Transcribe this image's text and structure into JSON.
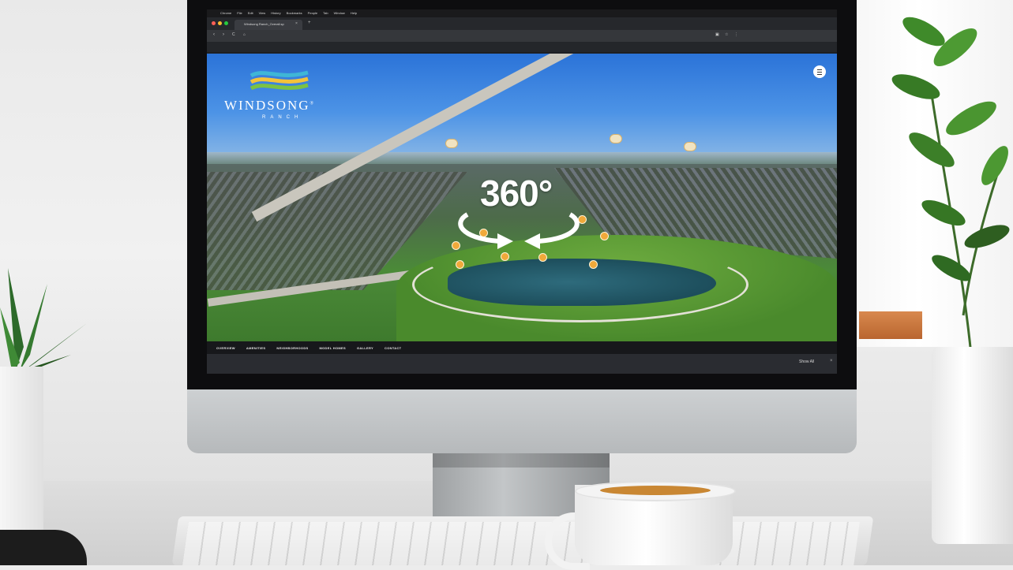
{
  "browser": {
    "menubar": {
      "items": [
        "Chrome",
        "File",
        "Edit",
        "View",
        "History",
        "Bookmarks",
        "People",
        "Tab",
        "Window",
        "Help"
      ]
    },
    "tab": {
      "title": "Windsong Ranch_Overall.sp",
      "close": "×"
    },
    "new_tab": "+",
    "toolbar": {
      "back": "‹",
      "forward": "›",
      "reload": "C"
    }
  },
  "site": {
    "logo": {
      "name": "WINDSONG",
      "trademark": "®",
      "sub": "RANCH"
    },
    "badge_360": "360°",
    "nav": [
      "OVERVIEW",
      "AMENITIES",
      "NEIGHBORHOODS",
      "MODEL HOMES",
      "GALLERY",
      "CONTACT"
    ]
  },
  "downloads_bar": {
    "show_all": "Show All",
    "close": "×"
  },
  "colors": {
    "sky": "#3f86df",
    "pin": "#f0a93a",
    "bezel": "#0d0d0f",
    "navbar": "#17181b"
  },
  "icons": [
    "apple-icon",
    "hamburger-menu-icon",
    "map-pin-icon",
    "beacon-icon",
    "360-arrows-icon",
    "windsong-wave-logo"
  ]
}
